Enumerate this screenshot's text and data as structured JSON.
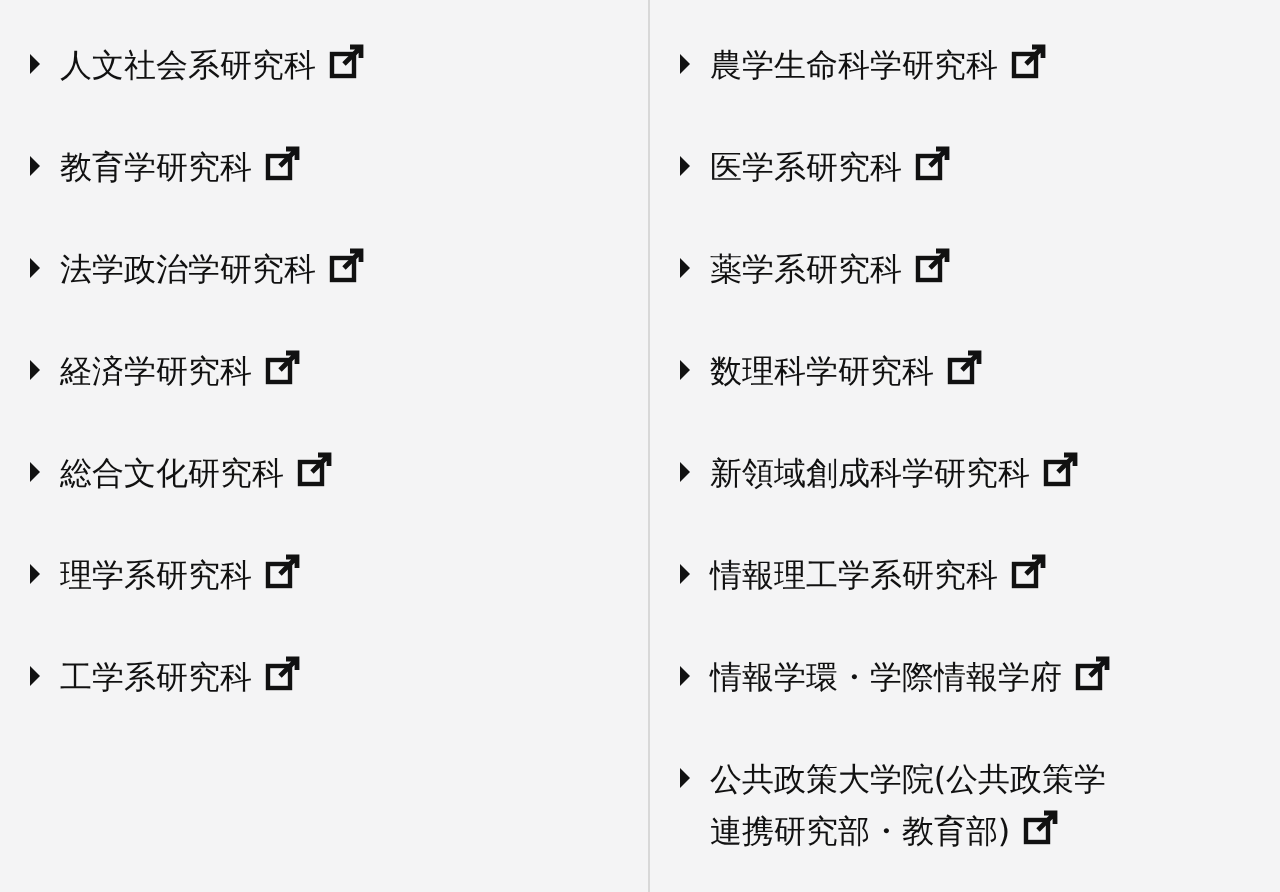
{
  "columns": [
    {
      "links": [
        {
          "label": "人文社会系研究科"
        },
        {
          "label": "教育学研究科"
        },
        {
          "label": "法学政治学研究科"
        },
        {
          "label": "経済学研究科"
        },
        {
          "label": "総合文化研究科"
        },
        {
          "label": "理学系研究科"
        },
        {
          "label": "工学系研究科"
        }
      ]
    },
    {
      "links": [
        {
          "label": "農学生命科学研究科"
        },
        {
          "label": "医学系研究科"
        },
        {
          "label": "薬学系研究科"
        },
        {
          "label": "数理科学研究科"
        },
        {
          "label": "新領域創成科学研究科"
        },
        {
          "label": "情報理工学系研究科"
        },
        {
          "label": "情報学環・学際情報学府"
        },
        {
          "label": "公共政策大学院(公共政策学連携研究部・教育部)"
        }
      ]
    }
  ]
}
